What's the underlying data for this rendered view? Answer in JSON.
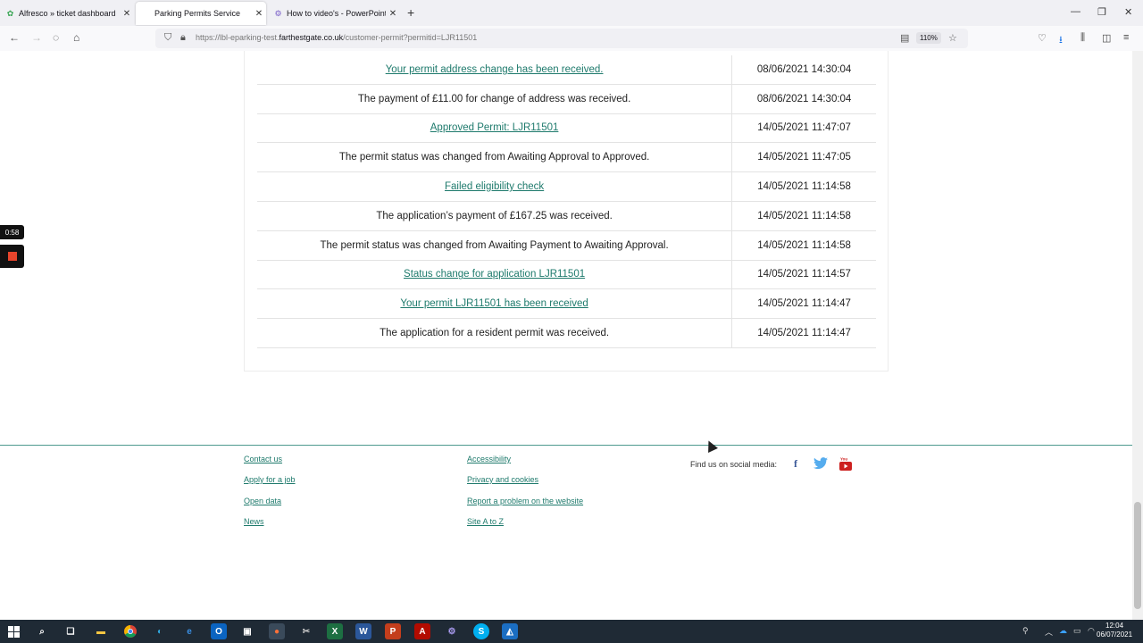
{
  "browser": {
    "tabs": [
      {
        "title": "Alfresco » ticket dashboard",
        "icon": "alfresco-icon",
        "color": "#3aa655"
      },
      {
        "title": "Parking Permits Service",
        "icon": "blank-page-icon",
        "color": "#ffffff"
      },
      {
        "title": "How to video's - PowerPoint Sli",
        "icon": "gear-icon",
        "color": "#7b61c9"
      }
    ],
    "url_prefix": "https://lbl-eparking-test.",
    "url_domain": "farthestgate.co.uk",
    "url_path": "/customer-permit?permitid=LJR11501",
    "zoom": "110%"
  },
  "history": [
    {
      "text": "Your permit address change has been received.",
      "date": "08/06/2021 14:30:04",
      "link": true
    },
    {
      "text": "The payment of £11.00 for change of address was received.",
      "date": "08/06/2021 14:30:04",
      "link": false
    },
    {
      "text": "Approved Permit: LJR11501",
      "date": "14/05/2021 11:47:07",
      "link": true
    },
    {
      "text": "The permit status was changed from Awaiting Approval to Approved.",
      "date": "14/05/2021 11:47:05",
      "link": false
    },
    {
      "text": "Failed eligibility check",
      "date": "14/05/2021 11:14:58",
      "link": true
    },
    {
      "text": "The application’s payment of £167.25 was received.",
      "date": "14/05/2021 11:14:58",
      "link": false
    },
    {
      "text": "The permit status was changed from Awaiting Payment to Awaiting Approval.",
      "date": "14/05/2021 11:14:58",
      "link": false
    },
    {
      "text": "Status change for application LJR11501",
      "date": "14/05/2021 11:14:57",
      "link": true
    },
    {
      "text": "Your permit LJR11501 has been received",
      "date": "14/05/2021 11:14:47",
      "link": true
    },
    {
      "text": "The application for a resident permit was received.",
      "date": "14/05/2021 11:14:47",
      "link": false
    }
  ],
  "footer": {
    "col1": [
      "Contact us",
      "Apply for a job",
      "Open data",
      "News"
    ],
    "col2": [
      "Accessibility",
      "Privacy and cookies",
      "Report a problem on the website",
      "Site A to Z"
    ],
    "social_label": "Find us on social media:",
    "social": [
      {
        "icon": "facebook-icon",
        "glyph": "f",
        "color": "#3b5998"
      },
      {
        "icon": "twitter-icon",
        "glyph": "🐦",
        "color": "#55acee"
      },
      {
        "icon": "youtube-icon",
        "glyph": "▶",
        "color": "#cd201f"
      }
    ]
  },
  "recorder": {
    "timer": "0:58",
    "stop_color": "#e8452c"
  },
  "taskbar": {
    "time": "12:04",
    "date": "06/07/2021"
  },
  "colors": {
    "link": "#1e7a6c",
    "footer_rule": "#4e9a8f"
  }
}
